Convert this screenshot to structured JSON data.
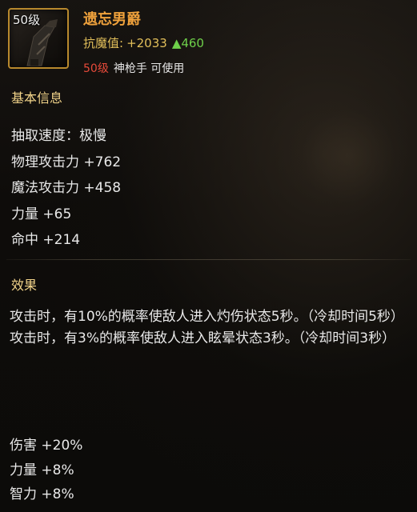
{
  "item": {
    "level_badge": "50级",
    "name": "遗忘男爵",
    "icon": "dark-gun-icon",
    "resist_label": "抗魔值:",
    "resist_value": "+2033",
    "resist_upgrade": "▲460",
    "req_level": "50级",
    "req_class": "神枪手 可使用"
  },
  "basic": {
    "title": "基本信息",
    "stats": [
      "抽取速度：极慢",
      "物理攻击力 +762",
      "魔法攻击力 +458",
      "力量 +65",
      "命中 +214"
    ]
  },
  "effect": {
    "title": "效果",
    "lines": [
      "攻击时，有10%的概率使敌人进入灼伤状态5秒。（冷却时间5秒）",
      "攻击时，有3%的概率使敌人进入眩晕状态3秒。（冷却时间3秒）"
    ],
    "bonuses": [
      "伤害 +20%",
      "力量 +8%",
      "智力 +8%"
    ]
  },
  "colors": {
    "name": "#f0a23c",
    "resist": "#e2bf5a",
    "upgrade": "#6ed04a",
    "req_level": "#e84a3a",
    "section_title": "#f2d48a",
    "frame": "#b8892d"
  }
}
